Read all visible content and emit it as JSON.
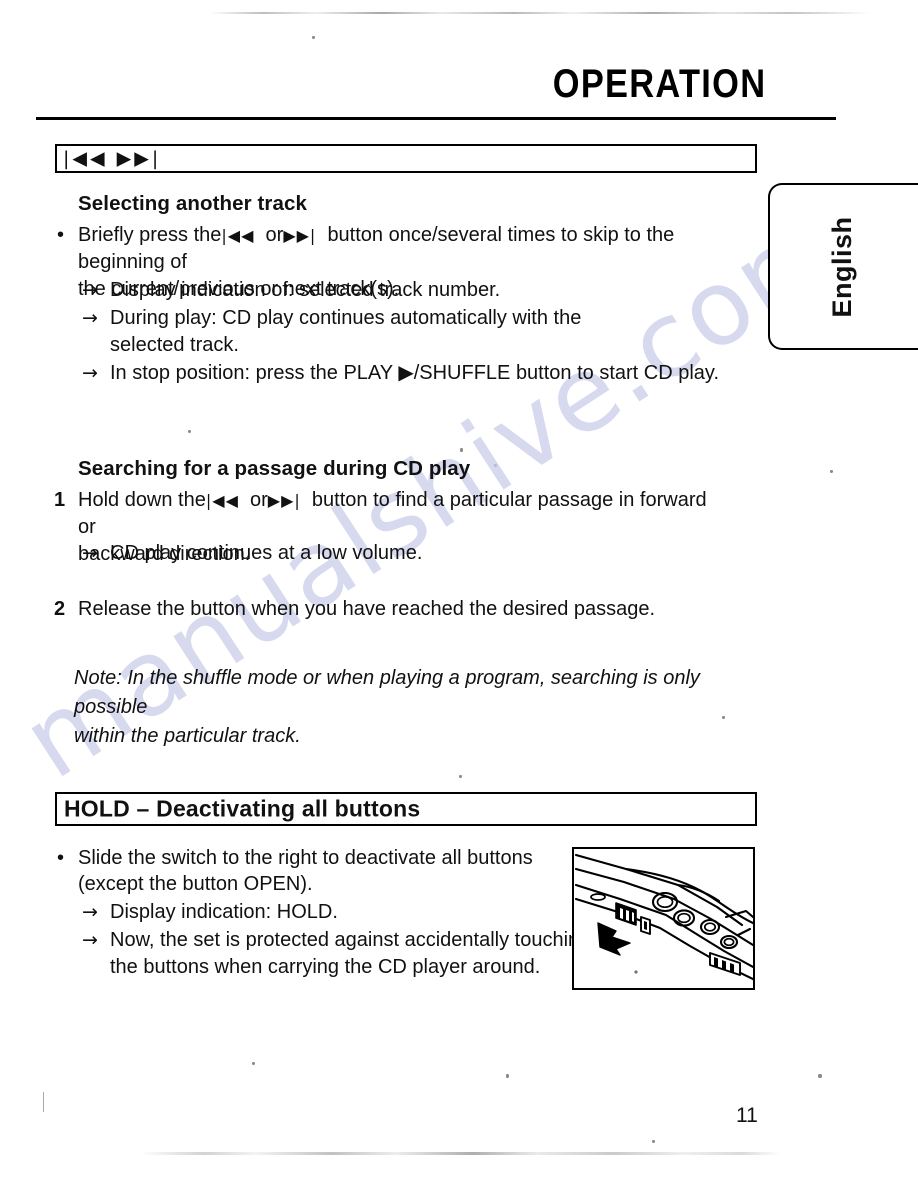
{
  "page": {
    "title": "OPERATION",
    "page_number": "11",
    "language_tab": "English",
    "watermark": "manualshive.com",
    "watermark_color": "#c9cbe8"
  },
  "banner": {
    "icons": "|◀◀  ▶▶|",
    "skip_back_icon": "skip-backward-icon",
    "skip_forward_icon": "skip-forward-icon"
  },
  "sections": {
    "selecting_track": {
      "heading": "Selecting another track",
      "bullet_marker": "•",
      "bullet_line_1_part_a": "Briefly press the",
      "bullet_line_1_icon_back": "|◀◀",
      "bullet_line_1_or": "or",
      "bullet_line_1_icon_fwd": "▶▶|",
      "bullet_line_1_part_b": "button once/several times to skip to the beginning of",
      "bullet_line_2": "the current/previous or next track(s).",
      "arrow": "→",
      "results": [
        "Display indication of: selected track number.",
        "During play: CD play continues automatically with the",
        "selected track.",
        "In stop position: press the PLAY ▶/SHUFFLE button to start CD play."
      ]
    },
    "searching_passage": {
      "heading": "Searching for a passage during CD play",
      "step_1_number": "1",
      "step_1_part_a": "Hold down the",
      "step_1_icon_back": "|◀◀",
      "step_1_or": "or",
      "step_1_icon_fwd": "▶▶|",
      "step_1_part_b": "button to find a particular passage in forward or",
      "step_1_line_2": "backward direction.",
      "arrow": "→",
      "step_1_result": "CD play continues at a low volume.",
      "step_2_number": "2",
      "step_2_text": "Release the button when you have reached the desired passage."
    },
    "note": {
      "line_1": "Note: In the shuffle mode or when playing a program, searching is only possible",
      "line_2": "within the particular track."
    },
    "hold": {
      "box_heading": "HOLD – Deactivating all buttons",
      "bullet_marker": "•",
      "bullet_line_1": "Slide the switch to the right to deactivate all buttons",
      "bullet_line_2": "(except the button OPEN).",
      "arrow": "→",
      "results": [
        "Display indication: HOLD.",
        "Now, the set is protected against accidentally touching of",
        "the buttons when carrying the CD player around."
      ],
      "illustration_name": "cd-player-hold-switch-diagram"
    }
  }
}
